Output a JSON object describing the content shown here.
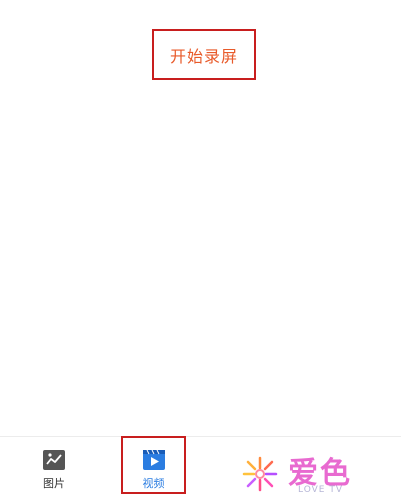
{
  "main": {
    "record_button_label": "开始录屏"
  },
  "bottom_nav": {
    "items": [
      {
        "label": "图片",
        "icon": "image-icon",
        "active": false
      },
      {
        "label": "视频",
        "icon": "video-icon",
        "active": true
      }
    ]
  },
  "watermark": {
    "title": "爱色",
    "subtitle": "LOVE TV"
  },
  "colors": {
    "highlight_border": "#c81e1e",
    "record_text": "#e85a2a",
    "active_tab": "#2b7de1"
  }
}
